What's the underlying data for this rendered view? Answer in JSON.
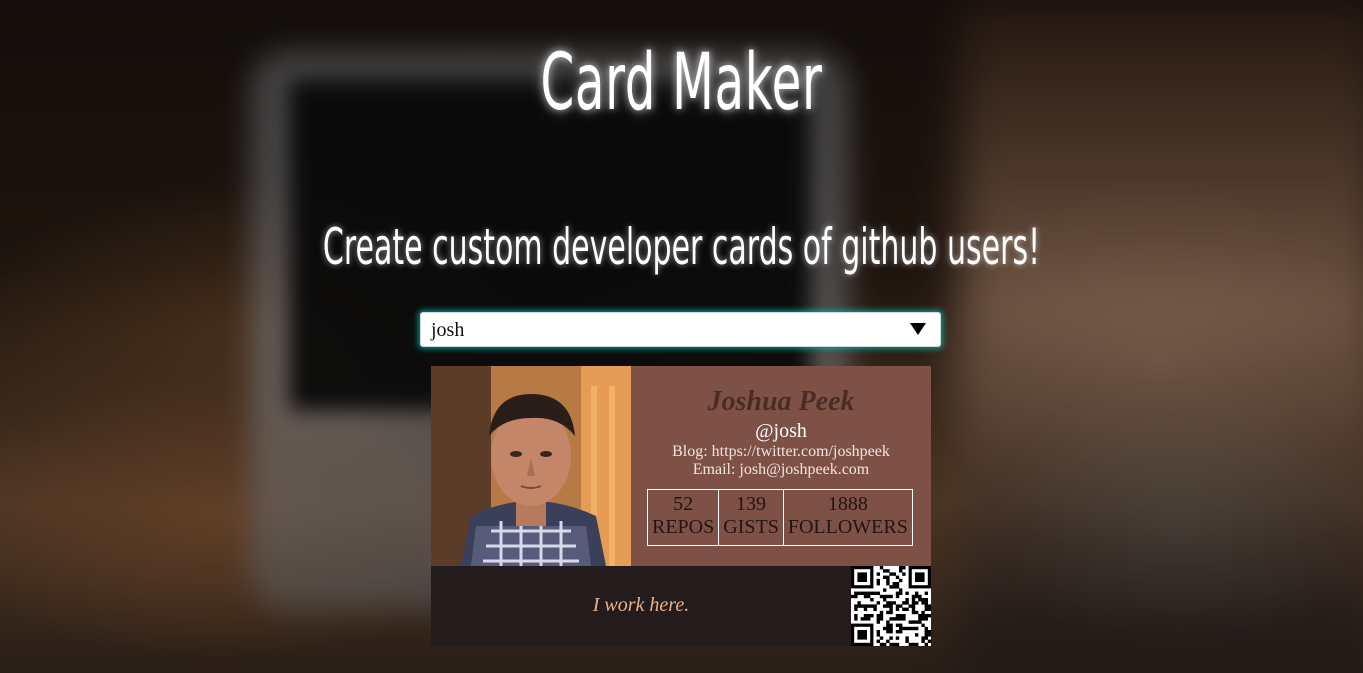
{
  "page": {
    "title": "Card Maker",
    "subtitle": "Create custom developer cards of github users!"
  },
  "search": {
    "selected_value": "josh"
  },
  "card": {
    "name": "Joshua Peek",
    "handle": "@josh",
    "blog": "Blog: https://twitter.com/joshpeek",
    "email": "Email: josh@joshpeek.com",
    "stats": [
      {
        "value": "52",
        "label": "REPOS"
      },
      {
        "value": "139",
        "label": "GISTS"
      },
      {
        "value": "1888",
        "label": "FOLLOWERS"
      }
    ],
    "tagline": "I work here."
  },
  "colors": {
    "card_top": "#7e5146",
    "card_bottom": "#241c1c",
    "tagline": "#e7b28d",
    "select_glow": "#00b4aa"
  },
  "icons": {
    "select_arrow": "chevron-down-icon",
    "qr": "qr-code-icon"
  }
}
